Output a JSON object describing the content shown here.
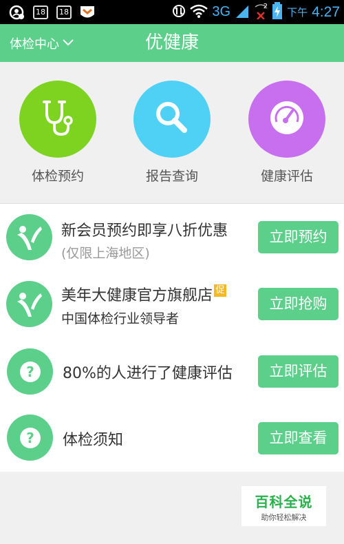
{
  "status_bar": {
    "network": "3G",
    "sim_badge_1": "18",
    "sim_badge_2": "18",
    "ampm": "下午",
    "time": "4:27",
    "signal_sub": "2"
  },
  "header": {
    "center_label": "体检中心",
    "title": "优健康"
  },
  "quick_actions": [
    {
      "label": "体检预约",
      "icon": "stethoscope-icon",
      "color": "#7ed321"
    },
    {
      "label": "报告查询",
      "icon": "search-icon",
      "color": "#4fd0f5"
    },
    {
      "label": "健康评估",
      "icon": "gauge-icon",
      "color": "#c86ff0"
    }
  ],
  "list": [
    {
      "title": "新会员预约即享八折优惠",
      "subtitle": "(仅限上海地区)",
      "button": "立即预约",
      "icon": "person-icon"
    },
    {
      "title": "美年大健康官方旗舰店",
      "badge": "促",
      "subtitle": "中国体检行业领导者",
      "button": "立即抢购",
      "icon": "person-icon"
    },
    {
      "title": "80%的人进行了健康评估",
      "button": "立即评估",
      "icon": "question-icon"
    },
    {
      "title": "体检须知",
      "button": "立即查看",
      "icon": "question-icon"
    }
  ],
  "watermark": {
    "title": "百科全说",
    "subtitle": "助你轻松解决"
  },
  "colors": {
    "accent": "#5ccf8a",
    "promo_badge": "#f5b922"
  }
}
